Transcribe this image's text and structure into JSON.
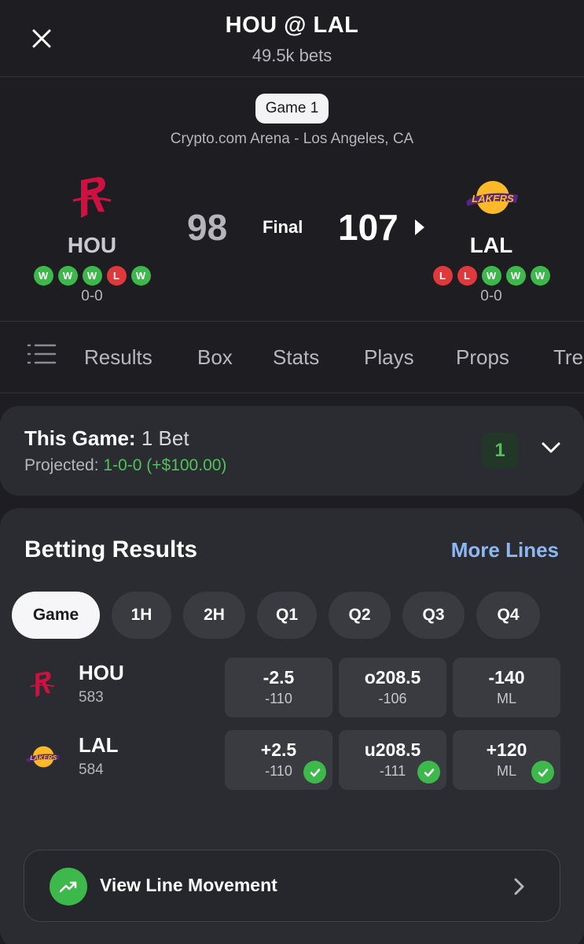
{
  "header": {
    "title": "HOU @ LAL",
    "subtitle": "49.5k bets"
  },
  "game": {
    "label": "Game 1",
    "venue": "Crypto.com Arena - Los Angeles, CA",
    "status": "Final",
    "away": {
      "abbr": "HOU",
      "score": "98",
      "record": "0-0",
      "form": [
        "W",
        "W",
        "W",
        "L",
        "W"
      ],
      "logo_icon": "rockets-logo-icon",
      "color": "#ce1141"
    },
    "home": {
      "abbr": "LAL",
      "score": "107",
      "record": "0-0",
      "form": [
        "L",
        "L",
        "W",
        "W",
        "W"
      ],
      "logo_icon": "lakers-logo-icon",
      "colors": [
        "#552583",
        "#fdb927"
      ]
    }
  },
  "tabs": [
    "Results",
    "Box",
    "Stats",
    "Plays",
    "Props",
    "Tre"
  ],
  "this_game": {
    "title_bold": "This Game:",
    "title_rest": "1 Bet",
    "projected_label": "Projected:",
    "projected_value": "1-0-0 (+$100.00)",
    "count": "1"
  },
  "betting_results": {
    "title": "Betting Results",
    "more_lines": "More Lines",
    "periods": [
      "Game",
      "1H",
      "2H",
      "Q1",
      "Q2",
      "Q3",
      "Q4"
    ],
    "active_period": "Game",
    "rows": [
      {
        "abbr": "HOU",
        "number": "583",
        "spread": {
          "main": "-2.5",
          "sub": "-110",
          "won": false
        },
        "total": {
          "main": "o208.5",
          "sub": "-106",
          "won": false
        },
        "moneyline": {
          "main": "-140",
          "sub": "ML",
          "won": false
        }
      },
      {
        "abbr": "LAL",
        "number": "584",
        "spread": {
          "main": "+2.5",
          "sub": "-110",
          "won": true
        },
        "total": {
          "main": "u208.5",
          "sub": "-111",
          "won": true
        },
        "moneyline": {
          "main": "+120",
          "sub": "ML",
          "won": true
        }
      }
    ],
    "line_movement": "View Line Movement"
  },
  "colors": {
    "background": "#1e1e22",
    "card": "#2b2c31",
    "win": "#3cb94a",
    "loss": "#e0393b",
    "link": "#8db7f2"
  }
}
